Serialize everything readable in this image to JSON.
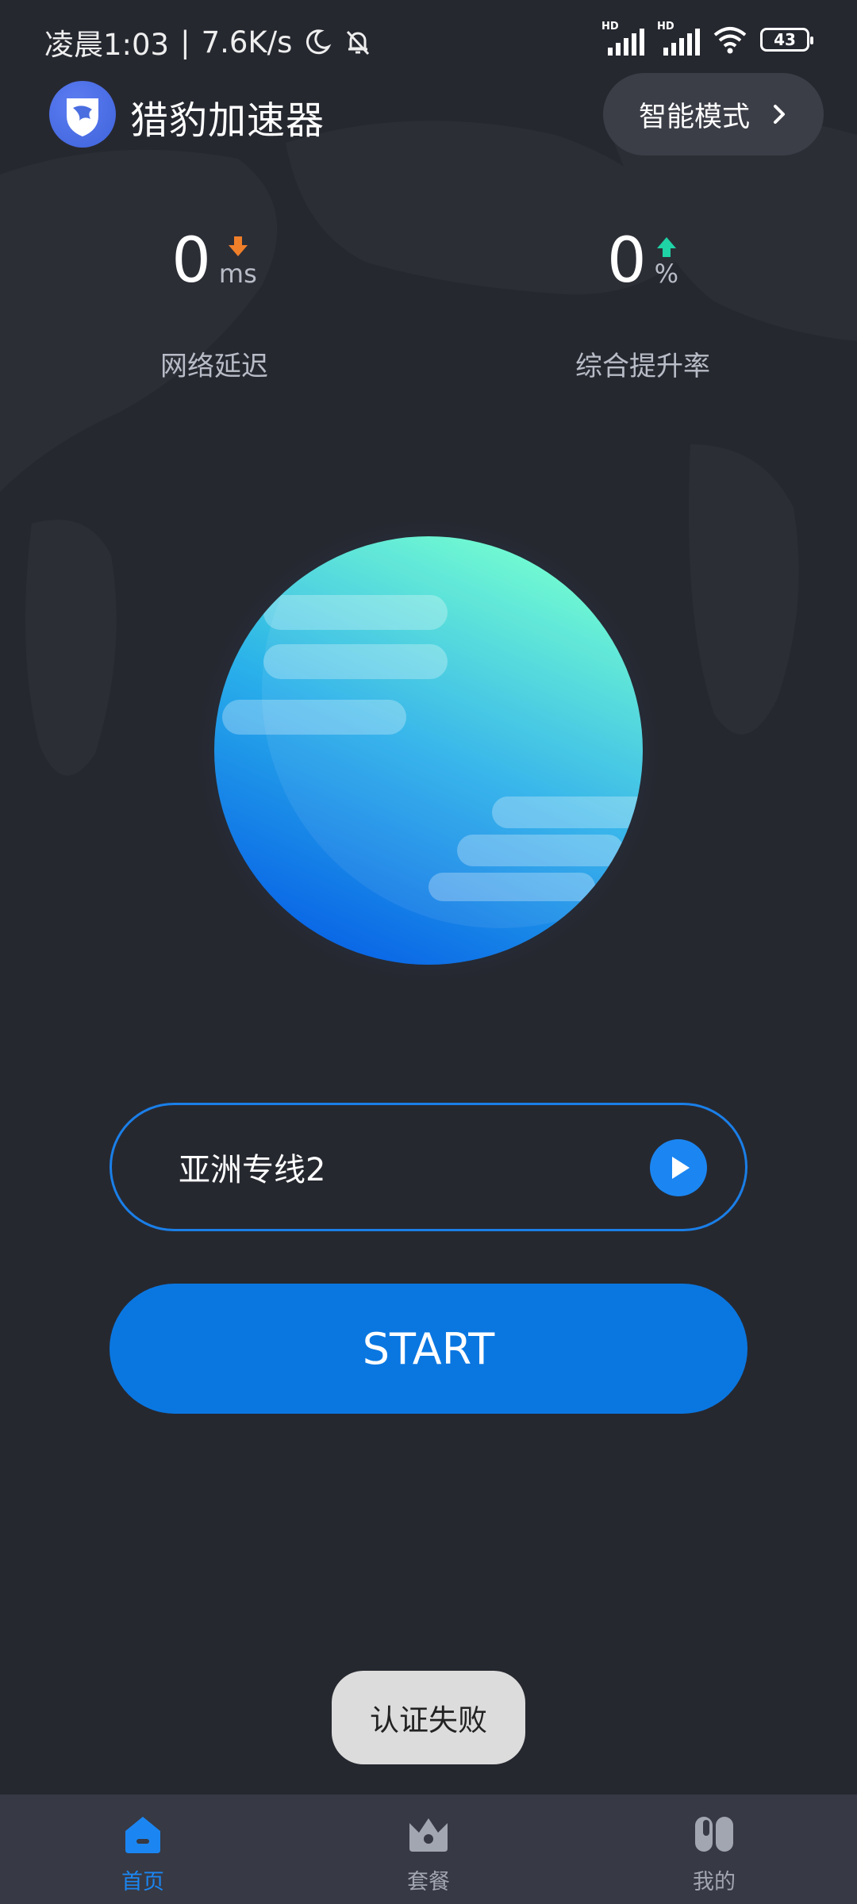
{
  "status_bar": {
    "time": "凌晨1:03",
    "net_speed": "7.6K/s",
    "signal_tag": "HD",
    "battery": "43",
    "icons": [
      "moon-icon",
      "bell-off-icon",
      "signal-icon",
      "wifi-icon",
      "battery-icon"
    ]
  },
  "header": {
    "app_title": "猎豹加速器",
    "mode_label": "智能模式"
  },
  "stats": {
    "latency": {
      "value": "0",
      "unit": "ms",
      "label": "网络延迟",
      "arrow": "down"
    },
    "boost": {
      "value": "0",
      "unit": "%",
      "label": "综合提升率",
      "arrow": "up"
    }
  },
  "line": {
    "name": "亚洲专线2"
  },
  "start_label": "START",
  "toast": "认证失败",
  "nav": [
    {
      "label": "首页",
      "icon": "home-icon",
      "active": true
    },
    {
      "label": "套餐",
      "icon": "crown-icon",
      "active": false
    },
    {
      "label": "我的",
      "icon": "profile-icon",
      "active": false
    }
  ],
  "colors": {
    "background": "#262830",
    "accent": "#1b86f2",
    "start_button": "#0a77e1",
    "latency_arrow": "#f07f2a",
    "boost_arrow": "#1fd3a6",
    "nav_bg": "#373944"
  }
}
